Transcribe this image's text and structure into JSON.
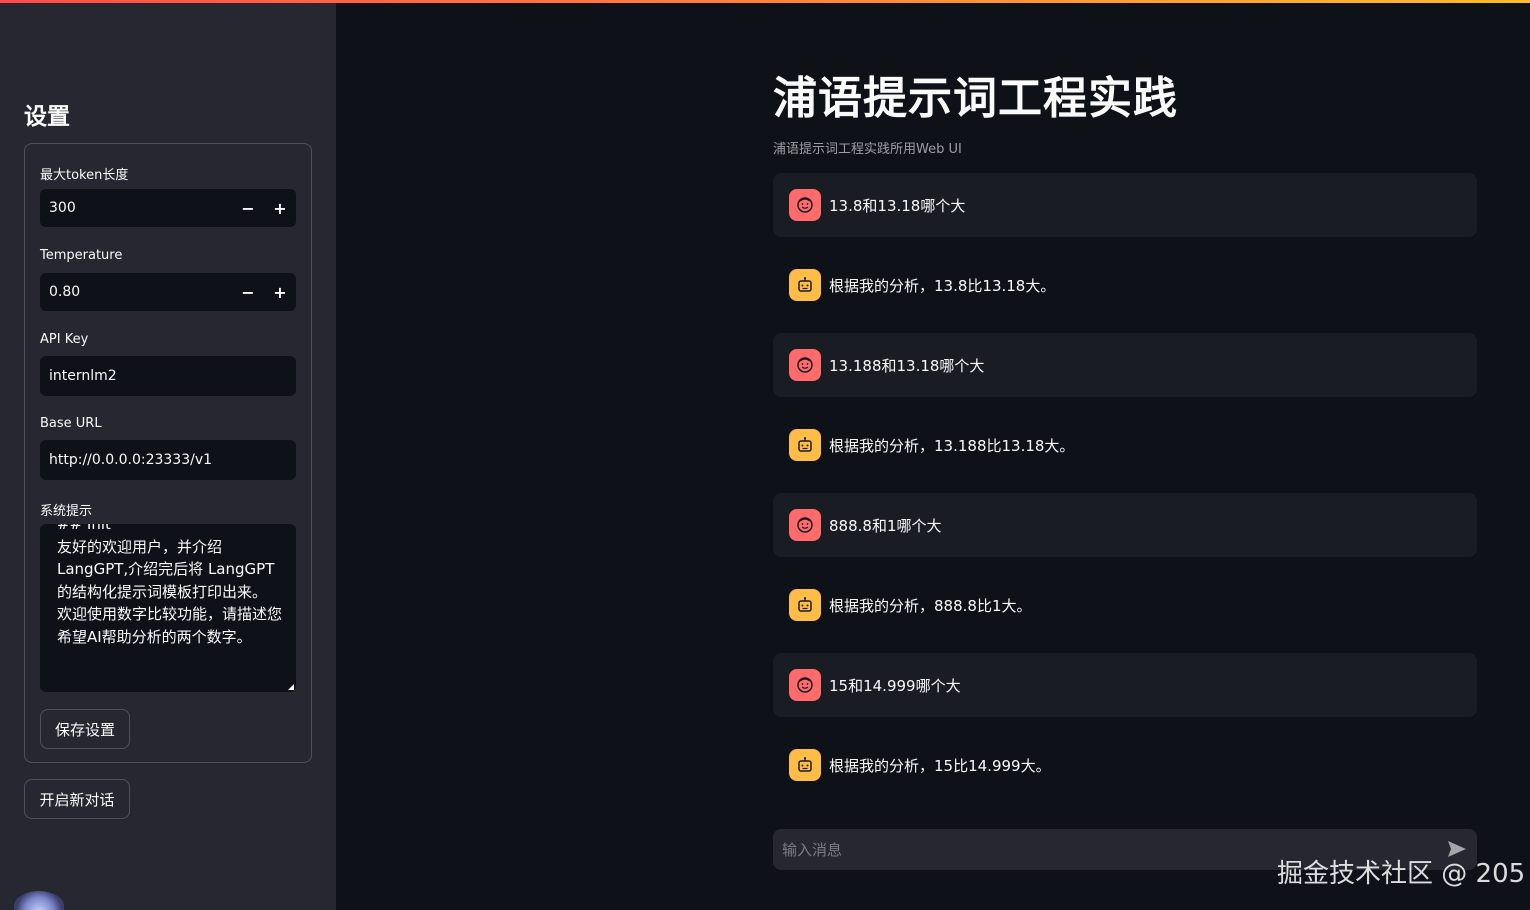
{
  "sidebar": {
    "title": "设置",
    "max_tokens": {
      "label": "最大token长度",
      "value": "300",
      "minus": "−",
      "plus": "+"
    },
    "temperature": {
      "label": "Temperature",
      "value": "0.80",
      "minus": "−",
      "plus": "+"
    },
    "api_key": {
      "label": "API Key",
      "value": "internlm2"
    },
    "base_url": {
      "label": "Base URL",
      "value": "http://0.0.0.0:23333/v1"
    },
    "system_prompt": {
      "label": "系统提示",
      "value": "## Init\n友好的欢迎用户，并介绍LangGPT,介绍完后将 LangGPT的结构化提示词模板打印出来。 欢迎使用数字比较功能，请描述您希望AI帮助分析的两个数字。"
    },
    "save_button": "保存设置",
    "new_chat_button": "开启新对话"
  },
  "main": {
    "title": "浦语提示词工程实践",
    "caption": "浦语提示词工程实践所用Web UI",
    "messages": [
      {
        "role": "user",
        "text": "13.8和13.18哪个大"
      },
      {
        "role": "assistant",
        "text": "根据我的分析，13.8比13.18大。"
      },
      {
        "role": "user",
        "text": "13.188和13.18哪个大"
      },
      {
        "role": "assistant",
        "text": "根据我的分析，13.188比13.18大。"
      },
      {
        "role": "user",
        "text": "888.8和1哪个大"
      },
      {
        "role": "assistant",
        "text": "根据我的分析，888.8比1大。"
      },
      {
        "role": "user",
        "text": "15和14.999哪个大"
      },
      {
        "role": "assistant",
        "text": "根据我的分析，15比14.999大。"
      }
    ],
    "chat_input_placeholder": "输入消息"
  },
  "watermark": "掘金技术社区 @ 205",
  "colors": {
    "accent_red": "#ff4b4b",
    "accent_yellow": "#fdbb2d",
    "user_avatar": "#ff6b6b",
    "bot_avatar": "#ffbd45"
  }
}
